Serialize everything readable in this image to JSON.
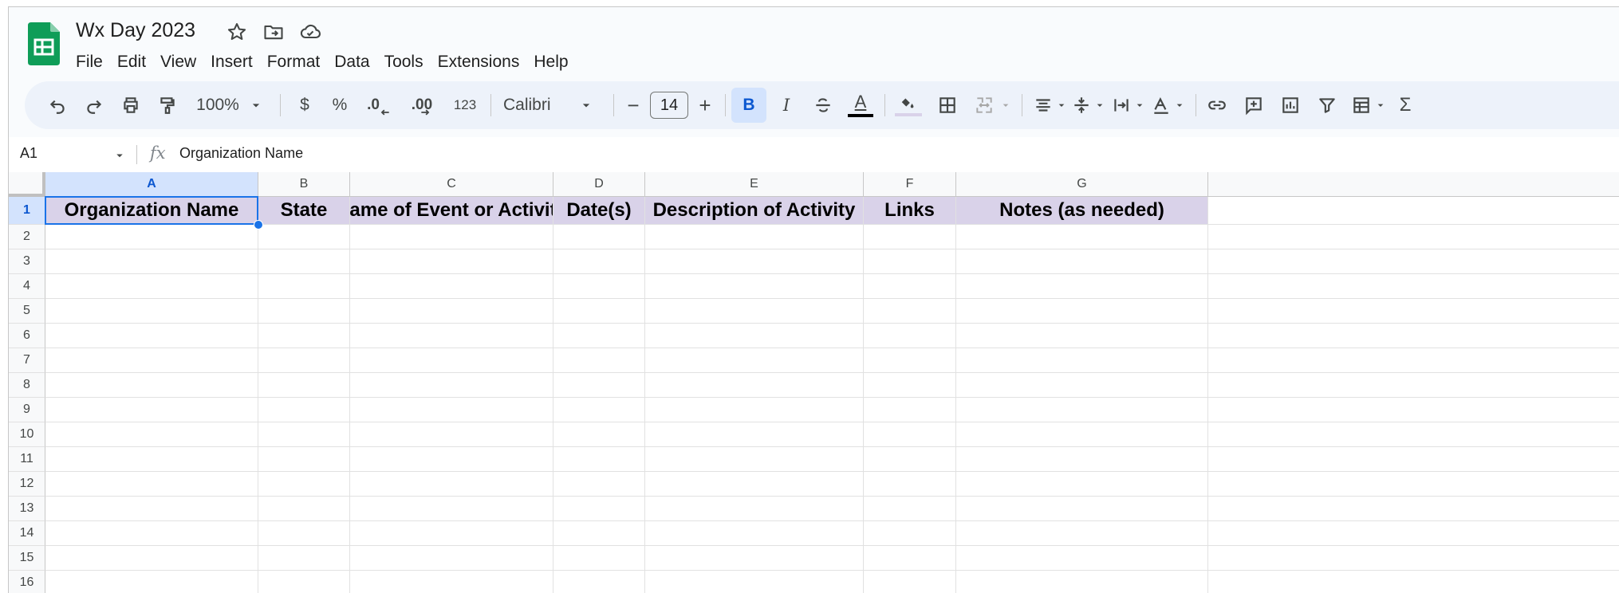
{
  "app": {
    "doc_title": "Wx Day 2023",
    "menu": [
      "File",
      "Edit",
      "View",
      "Insert",
      "Format",
      "Data",
      "Tools",
      "Extensions",
      "Help"
    ],
    "title_icons": [
      "star-icon",
      "move-to-folder-icon",
      "cloud-saved-icon"
    ]
  },
  "toolbar": {
    "zoom": "100%",
    "currency": "$",
    "percent": "%",
    "decrease_decimal": ".0",
    "increase_decimal": ".00",
    "number_format": "123",
    "font": "Calibri",
    "font_size": "14",
    "minus": "−",
    "plus": "+",
    "bold": "B",
    "italic": "I",
    "text_color_letter": "A",
    "sum": "Σ",
    "text_color_bar": "#000000",
    "fill_color_bar": "#d9d2e9"
  },
  "formula_bar": {
    "cell_ref": "A1",
    "fx": "fx",
    "content": "Organization Name"
  },
  "sheet": {
    "columns": [
      "A",
      "B",
      "C",
      "D",
      "E",
      "F",
      "G"
    ],
    "rows": [
      "1",
      "2",
      "3",
      "4",
      "5",
      "6",
      "7",
      "8",
      "9",
      "10",
      "11",
      "12",
      "13",
      "14",
      "15",
      "16"
    ],
    "header_row": [
      "Organization Name",
      "State",
      "Name of Event or Activity",
      "Date(s)",
      "Description of Activity",
      "Links",
      "Notes (as needed)"
    ],
    "header_fill": "#d9d2e9",
    "selected_cell": "A1",
    "selection_color": "#1a73e8"
  }
}
